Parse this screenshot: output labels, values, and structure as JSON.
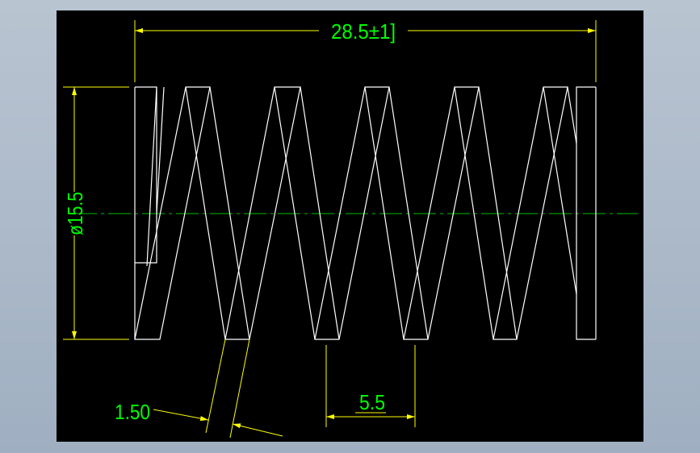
{
  "colors": {
    "background": "#000000",
    "outline": "#ffffff",
    "dimension_lines": "#ffff00",
    "dimension_text": "#00ff00",
    "centerline": "#00c000",
    "frame": "#a9b6c6"
  },
  "dimensions": {
    "free_length": "28.5±1]",
    "outer_diameter": "ø15.5",
    "pitch": "5.5",
    "wire_diameter": "1.50"
  }
}
